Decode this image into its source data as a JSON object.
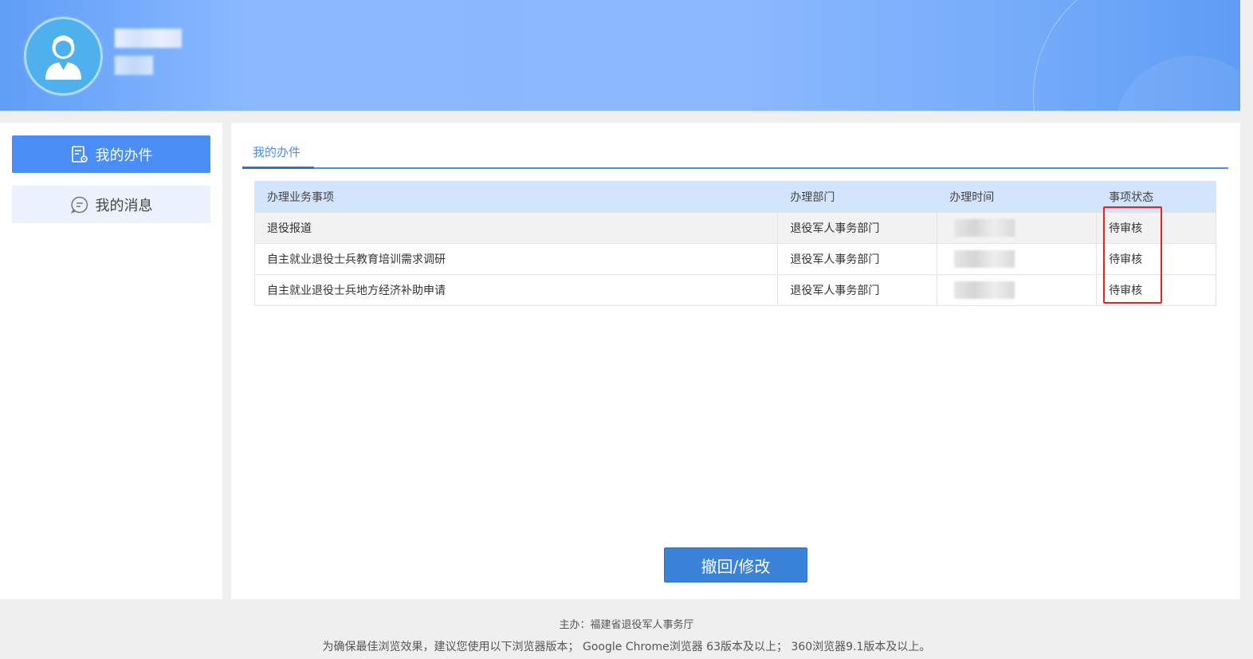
{
  "header": {
    "avatar_icon": "user-avatar-icon"
  },
  "sidebar": {
    "items": [
      {
        "label": "我的办件",
        "icon": "document-gear-icon",
        "active": true
      },
      {
        "label": "我的消息",
        "icon": "chat-bubble-icon",
        "active": false
      }
    ]
  },
  "main": {
    "tabs": [
      {
        "label": "我的办件"
      }
    ],
    "table": {
      "headers": [
        "办理业务事项",
        "办理部门",
        "办理时间",
        "事项状态"
      ],
      "rows": [
        {
          "item": "退役报道",
          "department": "退役军人事务部门",
          "status": "待审核"
        },
        {
          "item": "自主就业退役士兵教育培训需求调研",
          "department": "退役军人事务部门",
          "status": "待审核"
        },
        {
          "item": "自主就业退役士兵地方经济补助申请",
          "department": "退役军人事务部门",
          "status": "待审核"
        }
      ]
    },
    "action_button": "撤回/修改"
  },
  "footer": {
    "organizer": "主办：福建省退役军人事务厅",
    "browser_note": "为确保最佳浏览效果，建议您使用以下浏览器版本； Google Chrome浏览器 63版本及以上； 360浏览器9.1版本及以上。"
  },
  "colors": {
    "accent": "#4a8ef5",
    "button": "#3b82d9",
    "table_header": "#d3e4fd",
    "highlight": "#ef2020"
  }
}
